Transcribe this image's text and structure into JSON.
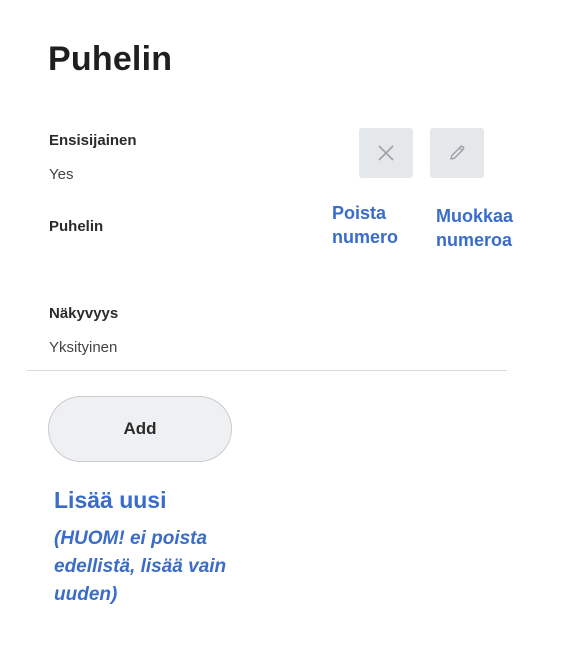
{
  "page": {
    "title": "Puhelin"
  },
  "fields": {
    "primary_label": "Ensisijainen",
    "primary_value": "Yes",
    "phone_label": "Puhelin",
    "visibility_label": "Näkyvyys",
    "visibility_value": "Yksityinen"
  },
  "actions": {
    "delete_icon": "close-icon",
    "edit_icon": "pencil-icon",
    "add_label": "Add"
  },
  "annotations": {
    "delete": [
      "Poista",
      "numero"
    ],
    "edit": [
      "Muokkaa",
      "numeroa"
    ],
    "add_title": "Lisää uusi",
    "add_note": "(HUOM! ei poista edellistä, lisää vain uuden)"
  },
  "colors": {
    "annotation": "#3a6cc9",
    "icon_button_bg": "#e5e8eb",
    "add_button_bg": "#eef0f2"
  }
}
